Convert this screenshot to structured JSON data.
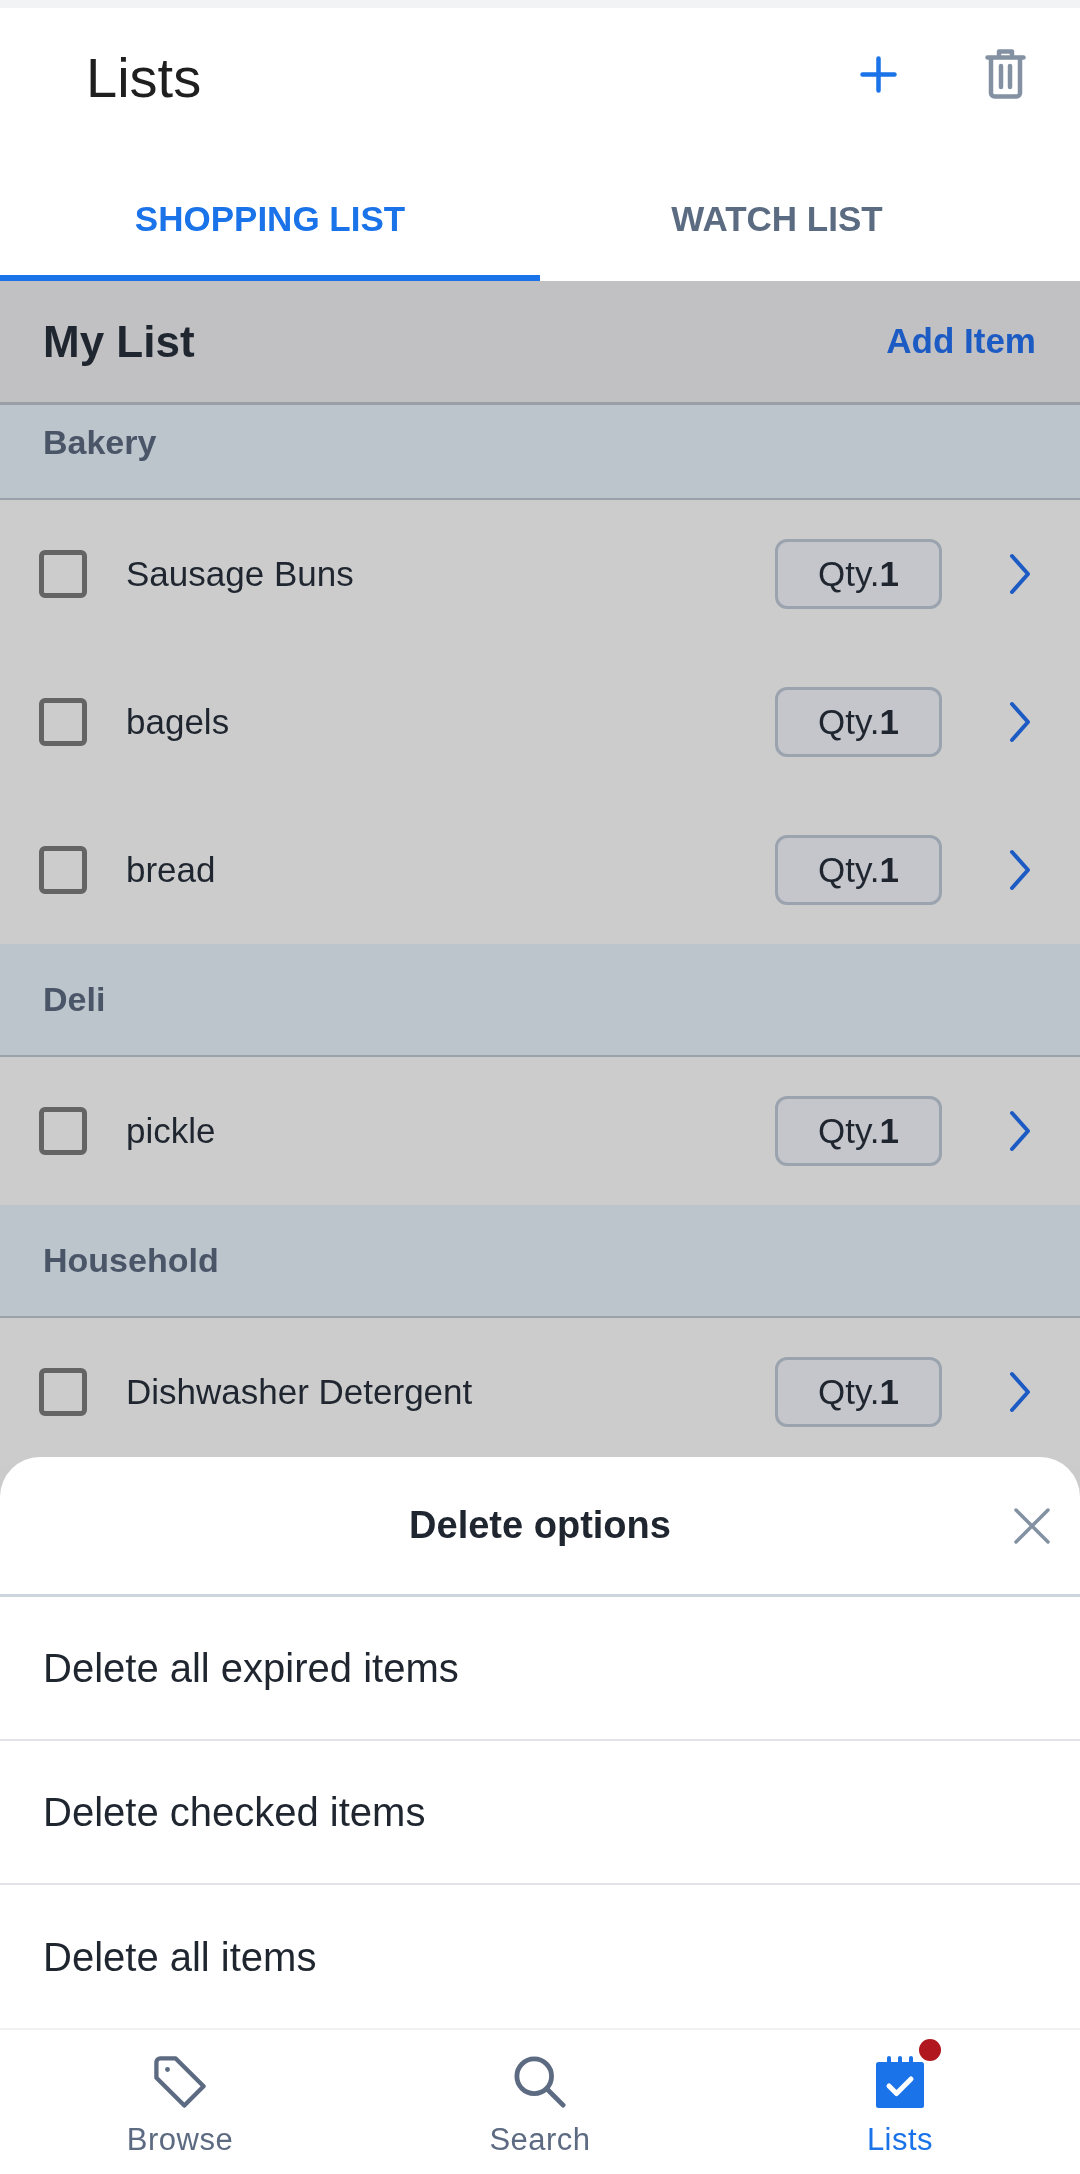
{
  "app_bar": {
    "title": "Lists"
  },
  "tabs": [
    {
      "label": "SHOPPING LIST",
      "selected": true
    },
    {
      "label": "WATCH LIST",
      "selected": false
    }
  ],
  "list_header": {
    "title": "My List",
    "action": "Add Item"
  },
  "sections": [
    {
      "name": "Bakery",
      "items": [
        {
          "name": "Sausage Buns",
          "checked": false,
          "quantity": "Qty.**1**"
        },
        {
          "name": "bagels",
          "checked": false,
          "quantity": "Qty.**1**"
        },
        {
          "name": "bread",
          "checked": false,
          "quantity": "Qty.**1**"
        }
      ]
    },
    {
      "name": "Deli",
      "items": [
        {
          "name": "pickle",
          "checked": false,
          "quantity": "Qty.**1**"
        }
      ]
    },
    {
      "name": "Household",
      "items": [
        {
          "name": "Dishwasher Detergent",
          "checked": false,
          "quantity": "Qty.**1**"
        }
      ]
    }
  ],
  "delete_sheet": {
    "title": "Delete options",
    "options": [
      "Delete all expired items",
      "Delete checked items",
      "Delete all items"
    ]
  },
  "bottom_nav": [
    {
      "label": "Browse",
      "selected": false,
      "badge": false
    },
    {
      "label": "Search",
      "selected": false,
      "badge": false
    },
    {
      "label": "Lists",
      "selected": true,
      "badge": true
    }
  ]
}
